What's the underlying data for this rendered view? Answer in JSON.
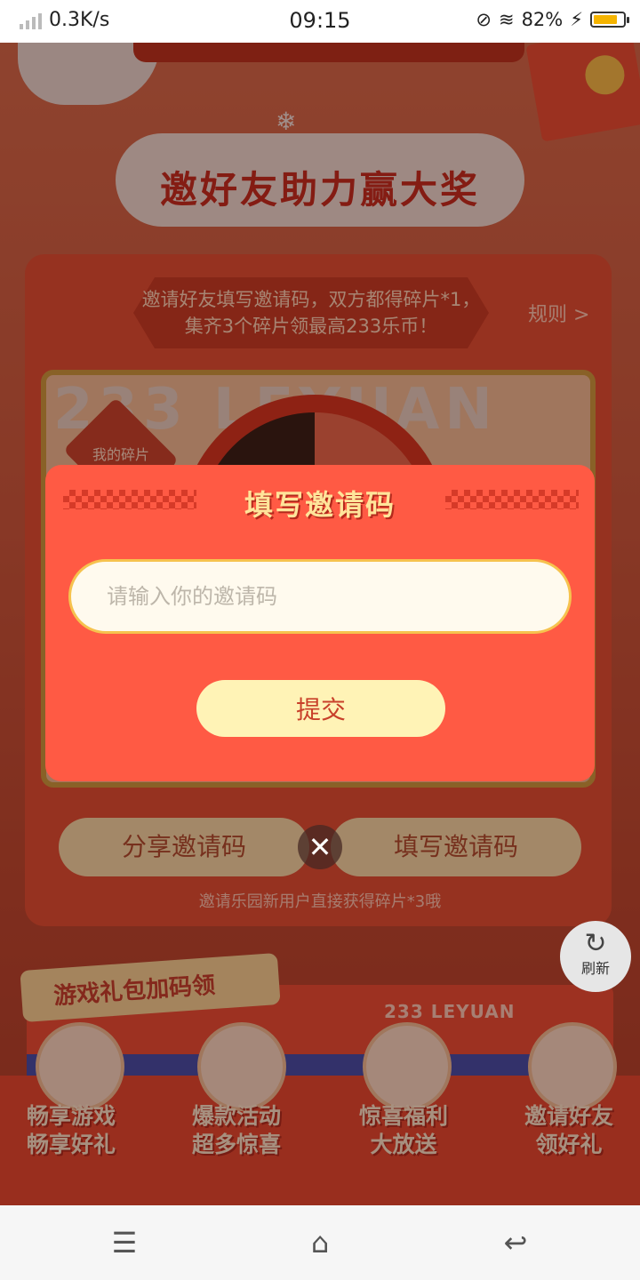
{
  "status_bar": {
    "network_speed": "0.3K/s",
    "time": "09:15",
    "battery_percent": "82%",
    "battery_level": 0.82,
    "icons": [
      "signal-icon",
      "no-nfc-icon",
      "wifi-icon",
      "charging-icon",
      "battery-icon"
    ]
  },
  "page": {
    "title": "邀好友助力赢大奖",
    "banner_text": "邀请好友填写邀请码，双方都得碎片*1，集齐3个碎片领最高233乐币！",
    "rules_link": "规则 >",
    "watermark": "233 LEYUAN",
    "fragment_tag": "我的碎片",
    "share_code_button": "分享邀请码",
    "fill_code_button": "填写邀请码",
    "invite_note": "邀请乐园新用户直接获得碎片*3哦",
    "refresh_label": "刷新",
    "gift_section_title": "游戏礼包加码领",
    "leyuan_label": "233 LEYUAN",
    "features": [
      {
        "line1": "畅享游戏",
        "line2": "畅享好礼"
      },
      {
        "line1": "爆款活动",
        "line2": "超多惊喜"
      },
      {
        "line1": "惊喜福利",
        "line2": "大放送"
      },
      {
        "line1": "邀请好友",
        "line2": "领好礼"
      }
    ]
  },
  "modal": {
    "title": "填写邀请码",
    "input_placeholder": "请输入你的邀请码",
    "input_value": "",
    "submit_label": "提交",
    "close_icon": "close-icon"
  },
  "navbar": {
    "icons": [
      "menu-icon",
      "home-icon",
      "back-icon"
    ]
  },
  "colors": {
    "modal_bg": "#ff5a44",
    "accent_yellow": "#ffe49a",
    "input_border": "#f6c24e",
    "submit_bg": "#fff3b6"
  }
}
